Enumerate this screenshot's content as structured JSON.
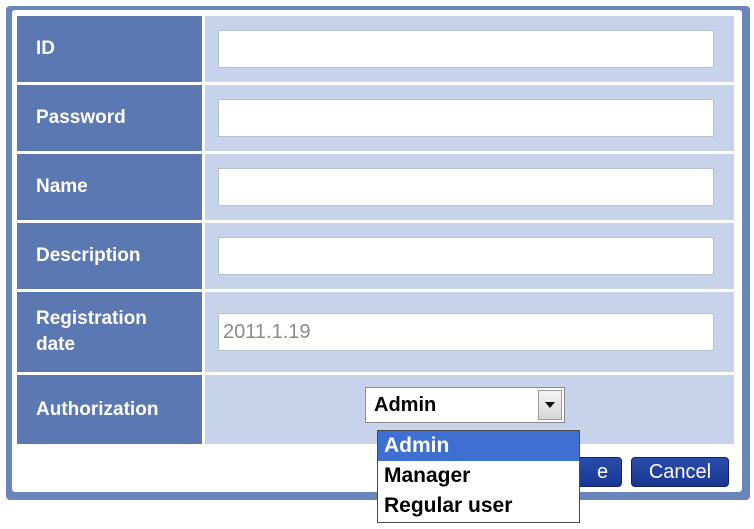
{
  "form": {
    "fields": [
      {
        "label": "ID",
        "value": ""
      },
      {
        "label": "Password",
        "value": ""
      },
      {
        "label": "Name",
        "value": ""
      },
      {
        "label": "Description",
        "value": ""
      },
      {
        "label": "Registration date",
        "label_line1": "Registration",
        "label_line2": "date",
        "value": "2011.1.19"
      }
    ],
    "authorization": {
      "label": "Authorization",
      "selected": "Admin",
      "options": [
        "Admin",
        "Manager",
        "Regular user"
      ]
    }
  },
  "buttons": {
    "save_partial": "e",
    "cancel": "Cancel"
  },
  "colors": {
    "label_bg": "#5b78b3",
    "value_bg": "#c6d3ea",
    "frame": "#6a85b9",
    "selected_option": "#3f6fd1",
    "button_bg": "#1a3691"
  }
}
